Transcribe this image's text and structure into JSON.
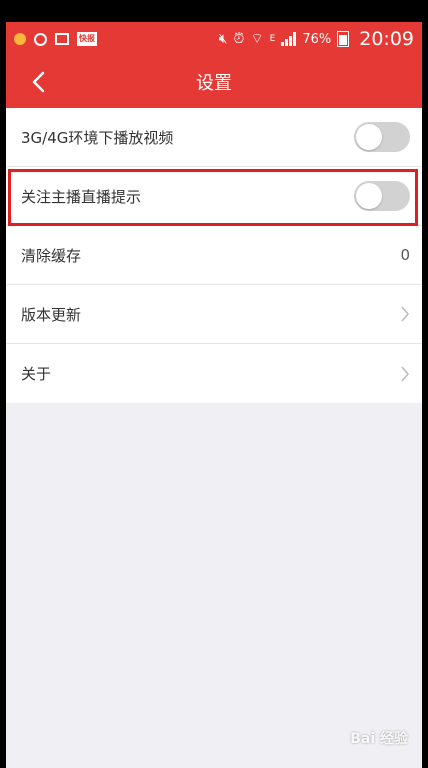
{
  "status_bar": {
    "carrier_mark": "E",
    "battery": "76%",
    "time": "20:09",
    "app_badge": "快报"
  },
  "header": {
    "title": "设置"
  },
  "settings": {
    "items": [
      {
        "label": "3G/4G环境下播放视频",
        "control": "toggle",
        "enabled": false
      },
      {
        "label": "关注主播直播提示",
        "control": "toggle",
        "enabled": false,
        "highlighted": true
      },
      {
        "label": "清除缓存",
        "value": "0"
      },
      {
        "label": "版本更新",
        "control": "chevron"
      },
      {
        "label": "关于",
        "control": "chevron"
      }
    ]
  },
  "watermark": "Bai 经验",
  "colors": {
    "brand": "#e53935",
    "highlight": "#e02020",
    "background": "#f0eff4"
  }
}
